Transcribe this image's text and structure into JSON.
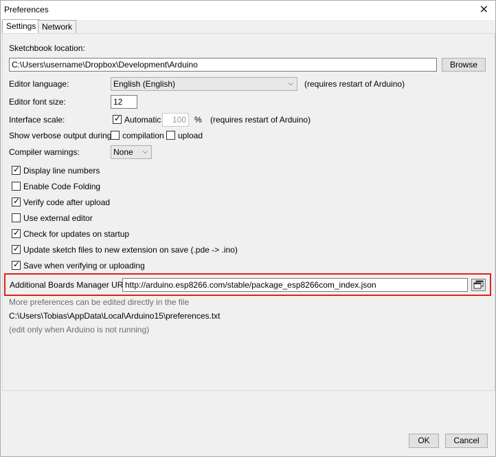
{
  "window": {
    "title": "Preferences",
    "close_glyph": "✕"
  },
  "tabs": [
    {
      "label": "Settings"
    },
    {
      "label": "Network"
    }
  ],
  "sketchbook": {
    "label": "Sketchbook location:",
    "value": "C:\\Users\\username\\Dropbox\\Development\\Arduino",
    "browse_label": "Browse"
  },
  "language": {
    "label": "Editor language:",
    "value": "English (English)",
    "note": "(requires restart of Arduino)"
  },
  "font_size": {
    "label": "Editor font size:",
    "value": "12"
  },
  "interface_scale": {
    "label": "Interface scale:",
    "automatic_label": "Automatic",
    "value": "100",
    "percent": "%",
    "note": "(requires restart of Arduino)"
  },
  "verbose": {
    "label": "Show verbose output during:",
    "compilation_label": "compilation",
    "upload_label": "upload"
  },
  "compiler_warnings": {
    "label": "Compiler warnings:",
    "value": "None"
  },
  "options": [
    {
      "label": "Display line numbers",
      "checked": true
    },
    {
      "label": "Enable Code Folding",
      "checked": false
    },
    {
      "label": "Verify code after upload",
      "checked": true
    },
    {
      "label": "Use external editor",
      "checked": false
    },
    {
      "label": "Check for updates on startup",
      "checked": true
    },
    {
      "label": "Update sketch files to new extension on save (.pde -> .ino)",
      "checked": true
    },
    {
      "label": "Save when verifying or uploading",
      "checked": true
    }
  ],
  "boards_urls": {
    "label": "Additional Boards Manager URLs:",
    "value": "http://arduino.esp8266.com/stable/package_esp8266com_index.json"
  },
  "footer_info": {
    "more_prefs": "More preferences can be edited directly in the file",
    "path": "C:\\Users\\Tobias\\AppData\\Local\\Arduino15\\preferences.txt",
    "note": "(edit only when Arduino is not running)"
  },
  "buttons": {
    "ok": "OK",
    "cancel": "Cancel"
  },
  "icons": {
    "checkbox_tick": "✓",
    "dropdown": "chevron-down-icon",
    "copy": "window-copy-icon",
    "close": "close-icon"
  },
  "colors": {
    "highlight": "#e02020"
  }
}
